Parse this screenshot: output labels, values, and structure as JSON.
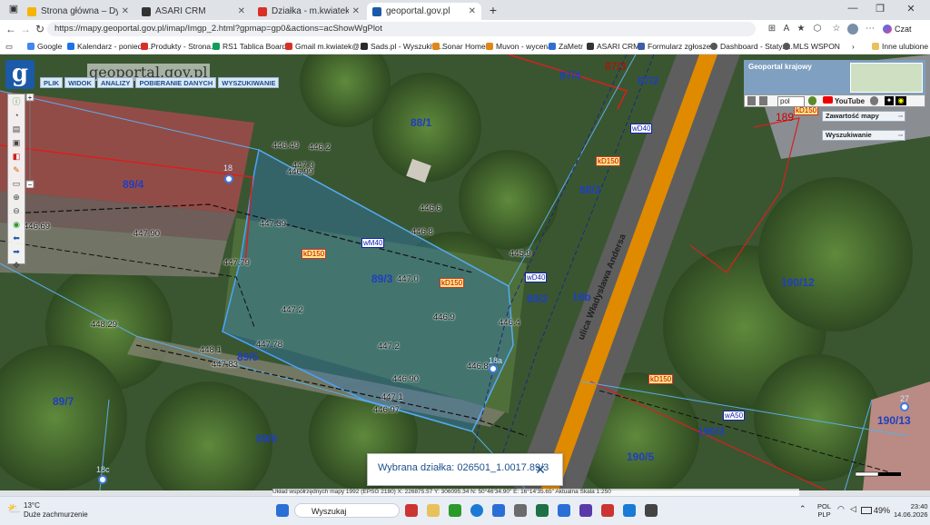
{
  "browser": {
    "tabs": [
      {
        "label": "Strona główna – Dysk Google",
        "active": false,
        "color": "#f4b400"
      },
      {
        "label": "ASARI CRM",
        "active": false,
        "color": "#333333"
      },
      {
        "label": "Działka - m.kwiatek@muvon.pl - k",
        "active": false,
        "color": "#d93025"
      },
      {
        "label": "geoportal.gov.pl",
        "active": true,
        "color": "#1b5aa8"
      }
    ],
    "new_tab": "+",
    "url": "https://mapy.geoportal.gov.pl/imap/Imgp_2.html?gpmap=gp0&actions=acShowWgPlot",
    "profile": "Czat",
    "bookmarks": [
      {
        "label": "Google",
        "color": "#4285f4"
      },
      {
        "label": "Kalendarz - poniedz...",
        "color": "#1a73e8"
      },
      {
        "label": "Produkty - Strona...",
        "color": "#d93025"
      },
      {
        "label": "RS1 Tablica Board...",
        "color": "#0f9d58"
      },
      {
        "label": "Gmail m.kwiatek@...",
        "color": "#d93025"
      },
      {
        "label": "Sads.pl - Wyszukiw...",
        "color": "#2b2b2b"
      },
      {
        "label": "Sonar Home",
        "color": "#e0861a"
      },
      {
        "label": "Muvon - wycena",
        "color": "#e0861a"
      },
      {
        "label": "ZaMetr",
        "color": "#2f6fd0"
      },
      {
        "label": "ASARI CRM",
        "color": "#333333"
      },
      {
        "label": "Formularz zgłosze...",
        "color": "#3b5ea8"
      },
      {
        "label": "Dashboard - Statys...",
        "color": "#555555"
      },
      {
        "label": "MLS WSPON",
        "color": "#555555"
      }
    ],
    "other_favorites": "Inne ulubione"
  },
  "geoportal": {
    "logo_letter": "g",
    "logo_text": "geoportal.gov.pl",
    "menu": [
      "PLIK",
      "WIDOK",
      "ANALIZY",
      "POBIERANIE DANYCH",
      "WYSZUKIWANIE"
    ],
    "panel_title": "Geoportal krajowy",
    "lang": "pol",
    "youtube": "YouTube",
    "section_map_content": "Zawartość mapy",
    "section_search": "Wyszukiwanie",
    "selected_plot_label": "Wybrana działka: 026501_1.0017.89/3",
    "status_line": "Układ współrzędnych mapy 1992 (EPSG 2180)   X: 226875.57 Y: 306095.34   N: 50°46'34.90\"  E: 16°14'35.65\"   Aktualna Skala 1:250"
  },
  "map_labels": {
    "plots": [
      "87/4",
      "87/3",
      "87/2",
      "88/1",
      "89/4",
      "88/2",
      "89/3",
      "89/2",
      "190/12",
      "89/5",
      "89/7",
      "89/6",
      "190/3",
      "190/5",
      "190/13",
      "189",
      "18b"
    ],
    "elevations": [
      "446.49",
      "446.2",
      "447.3",
      "446.99",
      "446.69",
      "447.39",
      "447.90",
      "446.6",
      "446.8",
      "447.79",
      "445.9",
      "447.0",
      "447.2",
      "446.9",
      "448.29",
      "447.78",
      "448.1",
      "447.83",
      "447.2",
      "446.90",
      "447.1",
      "446.97",
      "446.4",
      "446.8"
    ],
    "street": "ulica Władysława Andersa",
    "addresses": [
      "18",
      "18a",
      "18c",
      "27"
    ]
  },
  "taskbar": {
    "weather_temp": "13°C",
    "weather_desc": "Duże zachmurzenie",
    "search_placeholder": "Wyszukaj",
    "lang": "POL",
    "lang2": "PLP",
    "battery": "49%",
    "time": "23:40",
    "date": "14.06.2026"
  }
}
